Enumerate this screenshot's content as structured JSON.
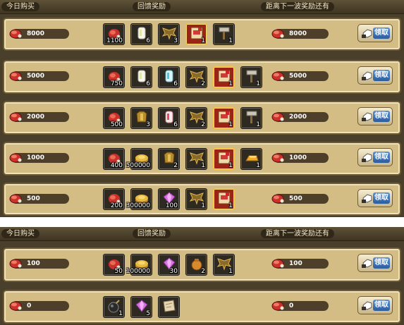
{
  "panels": [
    {
      "headers": [
        "今日购买",
        "回馈奖励",
        "距离下一波奖励还有"
      ],
      "rows": [
        {
          "cost": "8000",
          "next": "8000",
          "items": [
            {
              "icon": "meat-icon",
              "qty": "1100"
            },
            {
              "icon": "white-crystal-icon",
              "qty": "6"
            },
            {
              "icon": "wings-icon",
              "qty": "3"
            },
            {
              "icon": "scroll-card-icon",
              "qty": "1",
              "hl": true
            },
            {
              "icon": "hammer-icon",
              "qty": "1"
            }
          ]
        },
        {
          "cost": "5000",
          "next": "5000",
          "items": [
            {
              "icon": "meat-icon",
              "qty": "750"
            },
            {
              "icon": "white-crystal-icon",
              "qty": "6"
            },
            {
              "icon": "blue-crystal-icon",
              "qty": "6"
            },
            {
              "icon": "wings-icon",
              "qty": "2"
            },
            {
              "icon": "scroll-card-icon",
              "qty": "1",
              "hl": true
            },
            {
              "icon": "hammer-icon",
              "qty": "1"
            }
          ]
        },
        {
          "cost": "2000",
          "next": "2000",
          "items": [
            {
              "icon": "meat-icon",
              "qty": "500"
            },
            {
              "icon": "armor-icon",
              "qty": "3"
            },
            {
              "icon": "red-crystal-icon",
              "qty": "6"
            },
            {
              "icon": "wings-icon",
              "qty": "2"
            },
            {
              "icon": "scroll-card-icon",
              "qty": "1",
              "hl": true
            },
            {
              "icon": "hammer-icon",
              "qty": "1"
            }
          ]
        },
        {
          "cost": "1000",
          "next": "1000",
          "items": [
            {
              "icon": "meat-icon",
              "qty": "400"
            },
            {
              "icon": "gold-coin-icon",
              "qty": "500000"
            },
            {
              "icon": "armor-icon",
              "qty": "2"
            },
            {
              "icon": "wings-icon",
              "qty": "1"
            },
            {
              "icon": "scroll-card-icon",
              "qty": "1",
              "hl": true
            },
            {
              "icon": "gold-bar-icon",
              "qty": "1"
            }
          ]
        },
        {
          "cost": "500",
          "next": "500",
          "items": [
            {
              "icon": "meat-icon",
              "qty": "200"
            },
            {
              "icon": "gold-coin-icon",
              "qty": "300000"
            },
            {
              "icon": "purple-gem-icon",
              "qty": "100"
            },
            {
              "icon": "wings-icon",
              "qty": "1"
            },
            {
              "icon": "scroll-card-icon",
              "qty": "1",
              "hl": true
            }
          ]
        }
      ]
    },
    {
      "headers": [
        "今日购买",
        "回馈奖励",
        "距离下一波奖励还有"
      ],
      "rows": [
        {
          "cost": "100",
          "next": "100",
          "items": [
            {
              "icon": "meat-icon",
              "qty": "50"
            },
            {
              "icon": "gold-coin-icon",
              "qty": "100000"
            },
            {
              "icon": "purple-gem-icon",
              "qty": "30"
            },
            {
              "icon": "money-bag-icon",
              "qty": "2"
            },
            {
              "icon": "wings-icon",
              "qty": "1"
            }
          ]
        },
        {
          "cost": "0",
          "next": "0",
          "items": [
            {
              "icon": "bomb-icon",
              "qty": "1"
            },
            {
              "icon": "purple-gem-icon",
              "qty": "5"
            },
            {
              "icon": "map-scroll-icon",
              "qty": ""
            }
          ]
        }
      ]
    }
  ],
  "claim_label": "领取",
  "colors": {
    "row_bg": "#d3bd84",
    "row_border": "#6e5a33",
    "panel_bg": "#4a3f2a",
    "header_pill": "#2f2718"
  }
}
